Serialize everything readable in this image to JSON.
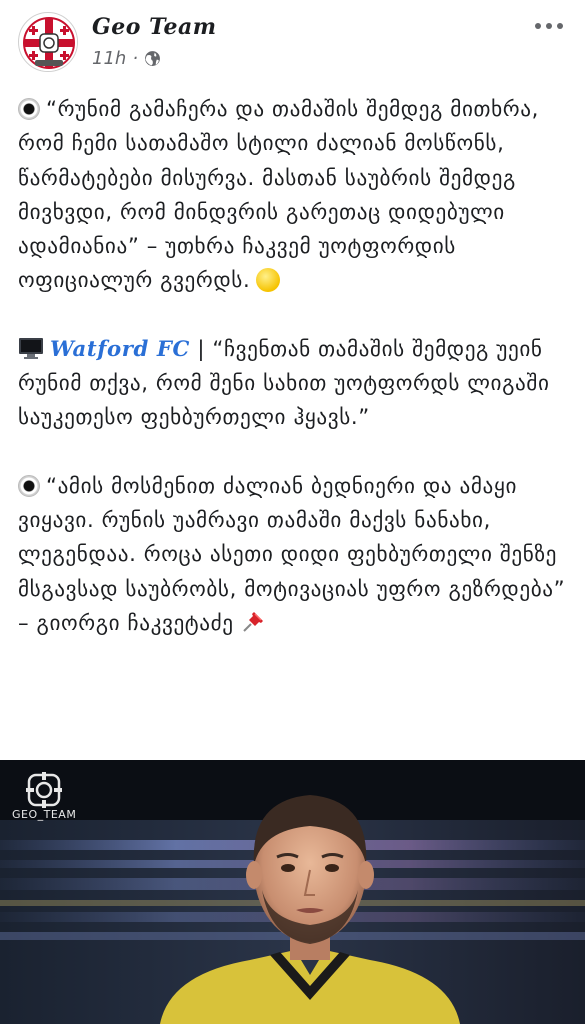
{
  "header": {
    "page_name": "Geo Team",
    "timestamp": "11h",
    "privacy_icon": "globe-icon",
    "more_icon": "more-options-icon"
  },
  "post": {
    "para1": "“რუნიმ გამაჩერა და თამაშის შემდეგ მითხრა, რომ ჩემი სათამაშო სტილი ძალიან მოსწონს, წარმატებები მისურვა. მასთან საუბრის შემდეგ მივხვდი, რომ მინდვრის გარეთაც დიდებული ადამიანია” – უთხრა ჩაკვემ უოტფორდის ოფიციალურ გვერდს.",
    "para2_link": "Watford FC",
    "para2_sep": " | ",
    "para2_text": "“ჩვენთან თამაშის შემდეგ უეინ რუნიმ თქვა, რომ შენი სახით უოტფორდს ლიგაში საუკეთესო ფეხბურთელი ჰყავს.”",
    "para3": "“ამის მოსმენით ძალიან ბედნიერი და ამაყი ვიყავი. რუნის უამრავი თამაში მაქვს ნანახი, ლეგენდაა. როცა ასეთი დიდი ფეხბურთელი შენზე მსგავსად საუბრობს, მოტივაციას უფრო გეზრდება” – გიორგი ჩაკვეტაძე"
  },
  "photo": {
    "watermark": "GEO_TEAM"
  },
  "colors": {
    "link": "#2a6fd6",
    "meta": "#65676b",
    "text": "#1c1e21"
  }
}
